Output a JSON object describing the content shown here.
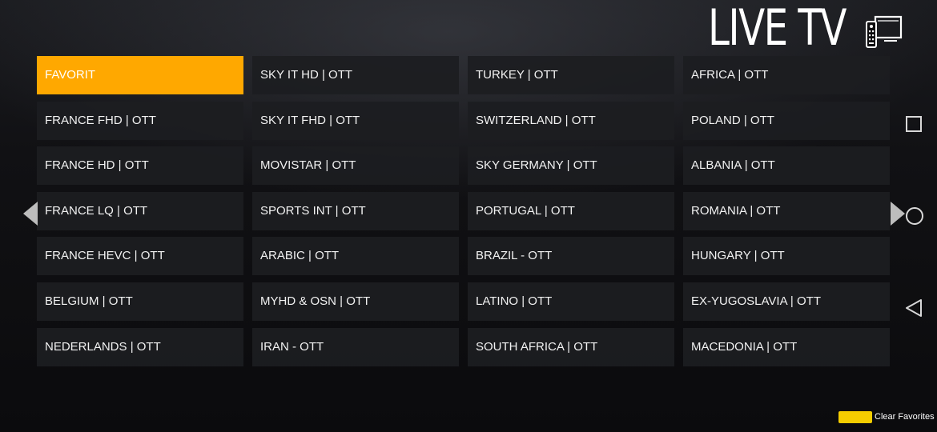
{
  "header": {
    "title": "LIVE TV",
    "icon": "tv-remote-icon"
  },
  "colors": {
    "accent": "#ffa800",
    "tile_bg": "#1c1d21",
    "text": "#ffffff",
    "clear_favorites_swatch": "#f5cd00"
  },
  "categories": [
    "FAVORIT",
    "SKY IT HD | OTT",
    "TURKEY | OTT",
    "AFRICA | OTT",
    "FRANCE FHD | OTT",
    "SKY IT FHD | OTT",
    "SWITZERLAND | OTT",
    "POLAND | OTT",
    "FRANCE HD | OTT",
    "MOVISTAR | OTT",
    "SKY GERMANY | OTT",
    "ALBANIA | OTT",
    "FRANCE LQ | OTT",
    "SPORTS INT | OTT",
    "PORTUGAL | OTT",
    "ROMANIA | OTT",
    "FRANCE HEVC | OTT",
    "ARABIC | OTT",
    "BRAZIL - OTT",
    "HUNGARY | OTT",
    "BELGIUM | OTT",
    "MYHD & OSN | OTT",
    "LATINO | OTT",
    "EX-YUGOSLAVIA | OTT",
    "NEDERLANDS | OTT",
    "IRAN - OTT",
    "SOUTH AFRICA | OTT",
    "MACEDONIA | OTT"
  ],
  "selected_index": 0,
  "nav": {
    "prev_icon": "chevron-left-icon",
    "next_icon": "chevron-right-icon",
    "recents_icon": "square-icon",
    "home_icon": "circle-icon",
    "back_icon": "triangle-back-icon"
  },
  "footer": {
    "clear_favorites_label": "Clear Favorites"
  }
}
